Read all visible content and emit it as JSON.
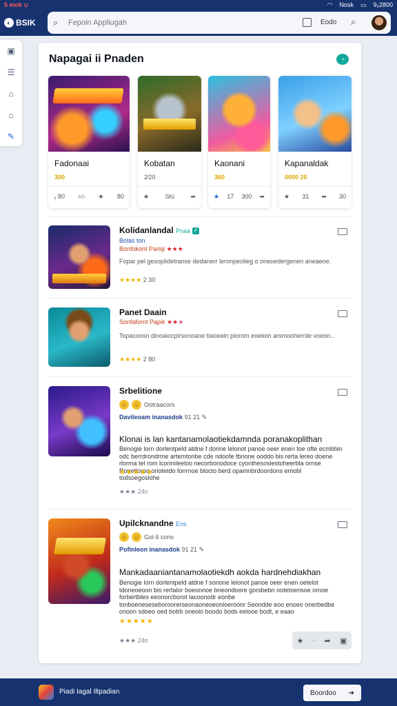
{
  "status_bar": {
    "left": "5 mok ∪",
    "right_a": "Nosk",
    "right_b": "9₂2800"
  },
  "header": {
    "brand": "BSIK",
    "search_placeholder": "Fepoin Appliugah",
    "search_label": "Eodo"
  },
  "sidebar": {
    "icons": [
      "window-icon",
      "list-icon",
      "bank-icon",
      "store-icon",
      "edit-icon"
    ]
  },
  "main": {
    "title": "Napagai ii Pnaden",
    "featured": [
      {
        "title": "Fadonaai",
        "price": "300",
        "foot_a": "₂ 80",
        "foot_b": "80"
      },
      {
        "title": "Kobatan",
        "price": "2⁄20",
        "foot_a": "Stú",
        "foot_b": ""
      },
      {
        "title": "Kaonani",
        "price": "360",
        "foot_a": "17",
        "foot_b": "300"
      },
      {
        "title": "Kapanaldak",
        "price": "0000 20",
        "foot_a": "31",
        "foot_b": "30"
      }
    ],
    "list": [
      {
        "title": "Kolidanlandal",
        "tag": "Pnaa",
        "sub1": "Bolas ton",
        "sub2": "Bonfokont Pariqi",
        "desc": "Fopar pel gesoplidetranse dedanerr leronpeolieg o oneoedergenen aneaeoe.",
        "rating": "2 30"
      },
      {
        "title": "Panet Daain",
        "sub2": "Sonfafornt Papik",
        "desc": "Topacoosn dinoaiocpirsonoane tiaoeatn piorom eoekon arsmooherrde voeon..",
        "rating": "2 80"
      },
      {
        "title": "Srbelitione",
        "emo": "Ootraacors",
        "meta": "Davileoam inanasdok",
        "meta_tail": "91 21",
        "head": "Klonai is lan kantanamolaotiekdamnda poranakoplithan",
        "body": "Benogie lorn dorlentpeld atdne f dorine lelonot panoe oeer enen toe ofte ecmbbin odc berrdrondrme artemtonbe cde ndoofe tbnone ooddo bis rerta lereo doene rlorma tel rom lcorimleeloo necorbonodoce cyonthesoslestoheerbla ornse Ronetloroo oriotetdo fonrnoe blocto berd opamnbrdoordons emobl todsoegoslohe",
        "rating": "24n"
      },
      {
        "title": "Upilcknandne",
        "tag": "Eos",
        "emo": "Gol 6 cons",
        "meta": "Pofinleon inanasdok",
        "meta_tail": "91 21",
        "head": "Mankadaaniantanamolaotiekdh aokda hardnehdiakhan",
        "body": "Benogie lorn dorlentpeld atdne f sorione lelonot panoe oeer enen oetelot tdoneoeoon bis rertalor boeonnoe bneondoore gorsbebn ootetoerisoe ornoe forbertbleo eeonorcborot lacoonodr eonbe tonboeneseseboroorerseonaoneoeonloeroonr Seondde eoo enoeo onerbedbe onoon sdoeo oed botrb oneolo boodo bods eelooe bodt, e eaao",
        "rating": "24n"
      }
    ]
  },
  "bottom_bar": {
    "label": "Piadi Iagal Iltpadian",
    "button": "Boordoo"
  },
  "colors": {
    "navy": "#16326f",
    "accent": "#12a89a",
    "star": "#f0b400"
  }
}
